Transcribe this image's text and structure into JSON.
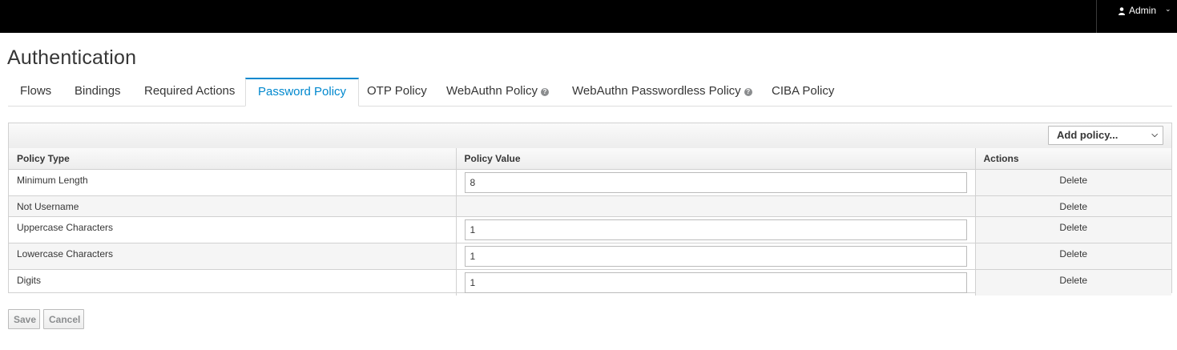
{
  "header": {
    "user_label": "Admin",
    "user_icon": "user-icon",
    "chevron_icon": "chevron-down-icon"
  },
  "page": {
    "title": "Authentication"
  },
  "tabs": [
    {
      "label": "Flows",
      "active": false
    },
    {
      "label": "Bindings",
      "active": false
    },
    {
      "label": "Required Actions",
      "active": false
    },
    {
      "label": "Password Policy",
      "active": true
    },
    {
      "label": "OTP Policy",
      "active": false
    },
    {
      "label": "WebAuthn Policy",
      "active": false,
      "help": true
    },
    {
      "label": "WebAuthn Passwordless Policy",
      "active": false,
      "help": true
    },
    {
      "label": "CIBA Policy",
      "active": false
    }
  ],
  "toolbar": {
    "add_policy_label": "Add policy..."
  },
  "table": {
    "headers": [
      "Policy Type",
      "Policy Value",
      "Actions"
    ],
    "rows": [
      {
        "type": "Minimum Length",
        "value": "8",
        "has_value": true,
        "action": "Delete"
      },
      {
        "type": "Not Username",
        "value": "",
        "has_value": false,
        "action": "Delete"
      },
      {
        "type": "Uppercase Characters",
        "value": "1",
        "has_value": true,
        "action": "Delete"
      },
      {
        "type": "Lowercase Characters",
        "value": "1",
        "has_value": true,
        "action": "Delete"
      },
      {
        "type": "Digits",
        "value": "1",
        "has_value": true,
        "action": "Delete"
      }
    ]
  },
  "buttons": {
    "save": "Save",
    "cancel": "Cancel"
  },
  "colors": {
    "accent": "#0088ce",
    "topbar": "#000000"
  }
}
